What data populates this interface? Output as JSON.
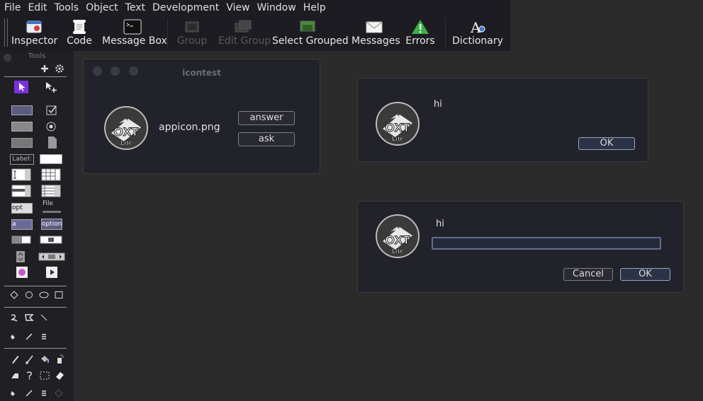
{
  "menu": [
    "File",
    "Edit",
    "Tools",
    "Object",
    "Text",
    "Development",
    "View",
    "Window",
    "Help"
  ],
  "toolbar": {
    "inspector": "Inspector",
    "code": "Code",
    "message_box": "Message Box",
    "group": "Group",
    "edit_group": "Edit Group",
    "select_grouped": "Select Grouped",
    "messages": "Messages",
    "errors": "Errors",
    "dictionary": "Dictionary"
  },
  "palette": {
    "title": "Tools",
    "label_tool": "Label:",
    "option_tool": "opt",
    "combo_tool": "a",
    "file_tool": "File",
    "menu_tool": "option"
  },
  "stack_window": {
    "title": "icontest",
    "filename": "appicon.png",
    "answer_button": "answer",
    "ask_button": "ask"
  },
  "answer_dialog": {
    "message": "hi",
    "ok_button": "OK"
  },
  "ask_dialog": {
    "message": "hi",
    "input_value": "",
    "cancel_button": "Cancel",
    "ok_button": "OK"
  },
  "logo": {
    "line1": "OXT",
    "line2": "Lite"
  },
  "colors": {
    "background": "#2b2b2b",
    "toolbar": "#1c1c22",
    "window": "#22222b",
    "default_button": "#2c3348",
    "pointer_tool": "#7b2fe0",
    "warning": "#3cb043"
  }
}
